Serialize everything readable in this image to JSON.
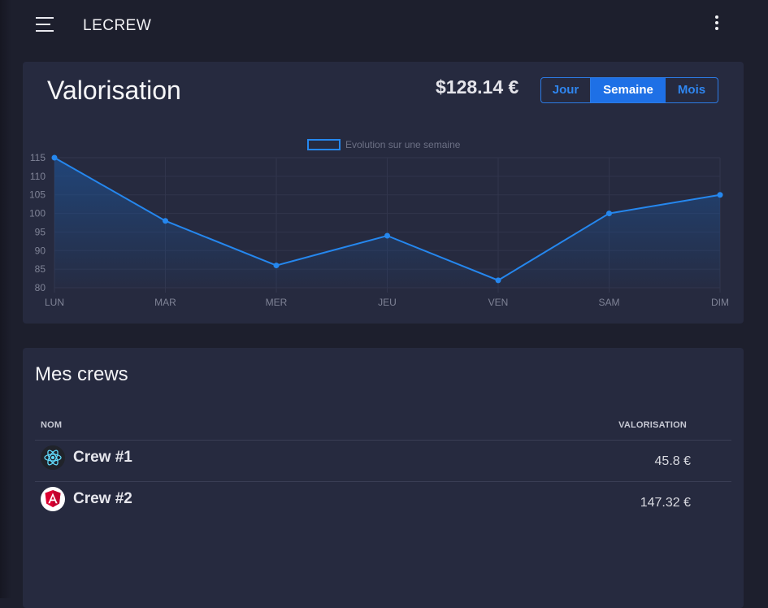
{
  "header": {
    "brand": "LECREW",
    "menu_icon": "hamburger-icon",
    "more_icon": "more-vertical-icon"
  },
  "valuation": {
    "title": "Valorisation",
    "amount": "$128.14 €",
    "period_buttons": [
      {
        "label": "Jour",
        "active": false
      },
      {
        "label": "Semaine",
        "active": true
      },
      {
        "label": "Mois",
        "active": false
      }
    ]
  },
  "chart_data": {
    "type": "area",
    "categories": [
      "LUN",
      "MAR",
      "MER",
      "JEU",
      "VEN",
      "SAM",
      "DIM"
    ],
    "series": [
      {
        "name": "Evolution sur une semaine",
        "values": [
          115,
          98,
          86,
          94,
          82,
          100,
          105
        ]
      }
    ],
    "ylim": [
      80,
      115
    ],
    "yticks": [
      80,
      85,
      90,
      95,
      100,
      105,
      110,
      115
    ],
    "grid": true,
    "legend": "top-center",
    "colors": {
      "line": "#2587ee",
      "fill": "#1f4e8c",
      "grid": "#31354c",
      "tick": "#7f8396"
    }
  },
  "crews": {
    "title": "Mes crews",
    "columns": {
      "name": "NOM",
      "value": "VALORISATION"
    },
    "rows": [
      {
        "name": "Crew #1",
        "value": "45.8 €",
        "icon": "react-icon"
      },
      {
        "name": "Crew #2",
        "value": "147.32 €",
        "icon": "angular-icon"
      }
    ]
  },
  "colors": {
    "background": "#1d1f2d",
    "card": "#262a3f",
    "accent": "#2c7be5"
  }
}
